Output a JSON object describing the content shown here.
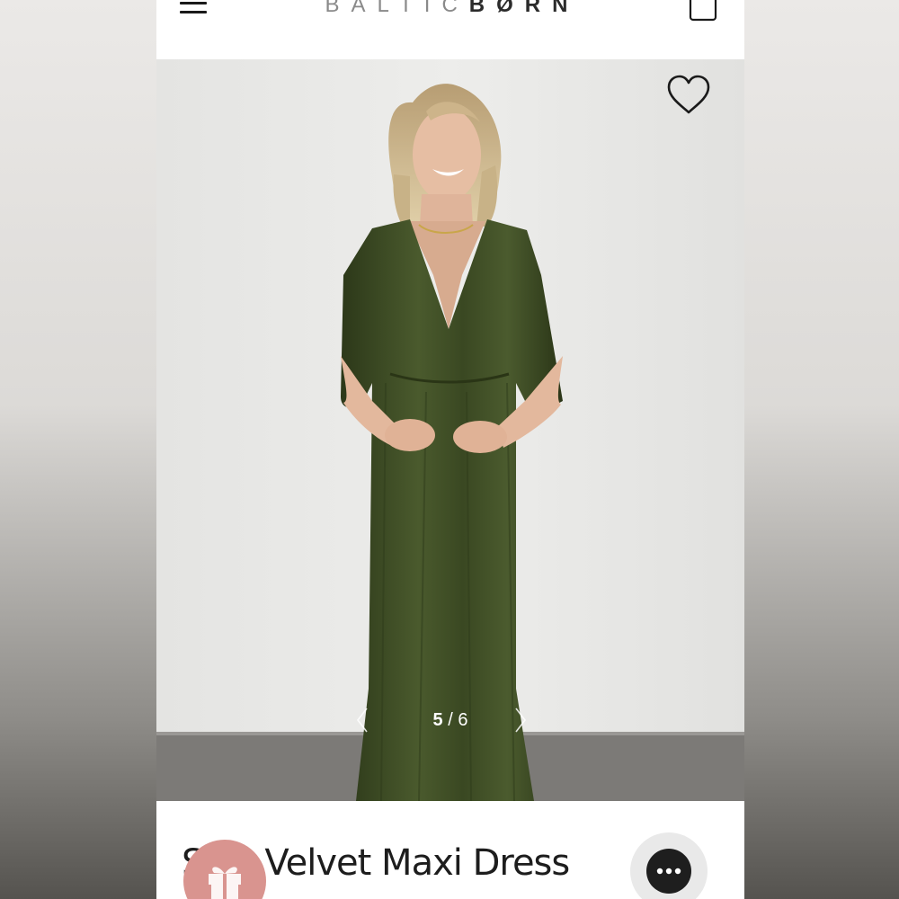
{
  "header": {
    "brand_part1": "BALTIC",
    "brand_part2": "BØRN",
    "menu_icon": "hamburger-icon",
    "cart_icon": "shopping-bag-icon"
  },
  "gallery": {
    "current_index": "5",
    "separator": "/",
    "total": "6",
    "favorite_icon": "heart-outline-icon",
    "prev_icon": "chevron-left-icon",
    "next_icon": "chevron-right-icon"
  },
  "product": {
    "title_visible": "Velvet Maxi Dress",
    "title_fragment": "S"
  },
  "widgets": {
    "gift_icon": "gift-icon",
    "chat_icon": "chat-ellipsis-icon",
    "gift_color": "#d9948f",
    "chat_color": "#1e1e1e"
  },
  "colors": {
    "dress": "#3c4a24",
    "wall": "#e8e8e6",
    "floor": "#7c7a77"
  }
}
